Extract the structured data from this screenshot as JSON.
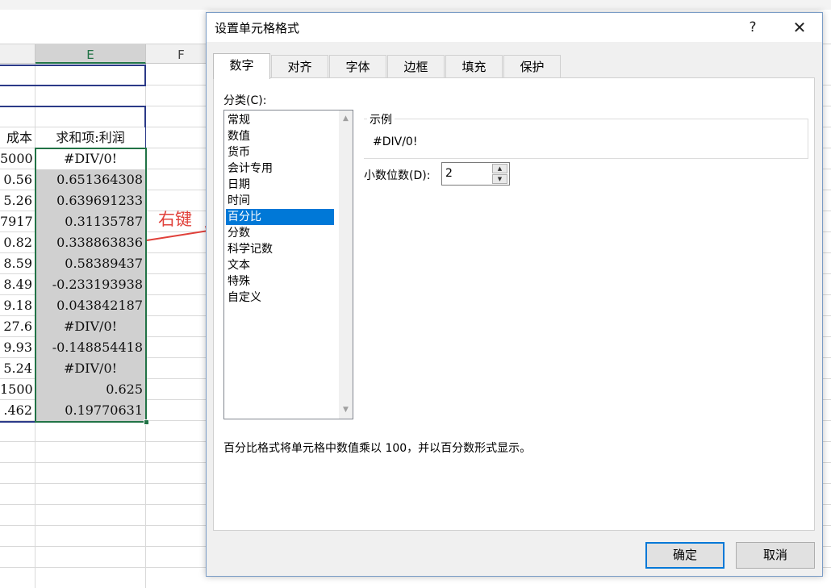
{
  "spreadsheet": {
    "columns": [
      "E",
      "F"
    ],
    "header_d": "成本",
    "header_e": "求和项:利润",
    "rows": [
      {
        "d": "5000",
        "e": "#DIV/0!"
      },
      {
        "d": "0.56",
        "e": "0.651364308"
      },
      {
        "d": "5.26",
        "e": "0.639691233"
      },
      {
        "d": "7917",
        "e": "0.31135787"
      },
      {
        "d": "0.82",
        "e": "0.338863836"
      },
      {
        "d": "8.59",
        "e": "0.58389437"
      },
      {
        "d": "8.49",
        "e": "-0.233193938"
      },
      {
        "d": "9.18",
        "e": "0.043842187"
      },
      {
        "d": "27.6",
        "e": "#DIV/0!"
      },
      {
        "d": "9.93",
        "e": "-0.148854418"
      },
      {
        "d": "5.24",
        "e": "#DIV/0!"
      },
      {
        "d": "1500",
        "e": "0.625"
      },
      {
        "d": ".462",
        "e": "0.19770631"
      }
    ]
  },
  "annotation": {
    "label": "右键",
    "color": "#e0403a"
  },
  "dialog": {
    "title": "设置单元格格式",
    "help": "?",
    "close": "✕",
    "tabs": [
      "数字",
      "对齐",
      "字体",
      "边框",
      "填充",
      "保护"
    ],
    "active_tab": "数字",
    "category_label": "分类(C):",
    "categories": [
      "常规",
      "数值",
      "货币",
      "会计专用",
      "日期",
      "时间",
      "百分比",
      "分数",
      "科学记数",
      "文本",
      "特殊",
      "自定义"
    ],
    "selected_category": "百分比",
    "sample_legend": "示例",
    "sample_value": "#DIV/0!",
    "decimal_label": "小数位数(D):",
    "decimal_value": "2",
    "description": "百分比格式将单元格中数值乘以 100，并以百分数形式显示。",
    "ok_label": "确定",
    "cancel_label": "取消"
  },
  "colors": {
    "selection": "#0078d7",
    "sheet_selection": "#217346",
    "ok_border": "#0078d7"
  }
}
